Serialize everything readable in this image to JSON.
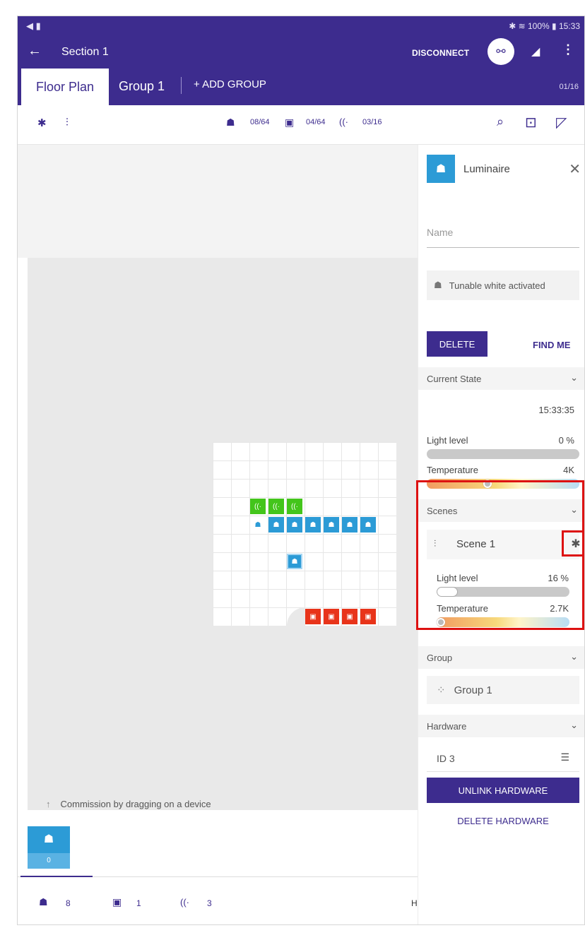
{
  "statusbar": {
    "left_icons": "◀ ▮",
    "right_text": "✱ ≋ 100% ▮ 15:33"
  },
  "appbar": {
    "back_icon": "←",
    "title": "Section 1",
    "disconnect_label": "DISCONNECT",
    "link_icon": "⚯",
    "signal_icon": "◢",
    "more_icon": "⋮"
  },
  "tabs": {
    "floor_plan": "Floor Plan",
    "group1": "Group 1",
    "add_group": "+ ADD GROUP",
    "count": "01/16"
  },
  "toolbar": {
    "settings_icon": "✱",
    "tune_icon": "⫶",
    "lum_icon": "☗",
    "lum_count": "08/64",
    "switch_icon": "▣",
    "switch_count": "04/64",
    "sensor_icon": "((·",
    "sensor_count": "03/16",
    "search_icon": "⌕",
    "fit_icon": "⊡",
    "expand_icon": "◸"
  },
  "canvas": {
    "hint_arrow": "↑",
    "hint": "Commission by dragging on a device"
  },
  "tile": {
    "icon": "☗",
    "count": "0"
  },
  "bottom": {
    "lum_icon": "☗",
    "lum": "8",
    "switch_icon": "▣",
    "switch": "1",
    "sensor_icon": "((·",
    "sensor": "3",
    "faded_label": "H"
  },
  "panel": {
    "icon": "☗",
    "title": "Luminaire",
    "close_icon": "✕",
    "name_placeholder": "Name",
    "tw_icon": "☗",
    "tunable": "Tunable white activated",
    "delete": "DELETE",
    "find_me": "FIND ME",
    "current_state": "Current State",
    "chevron": "⌄",
    "time": "15:33:35",
    "refresh_icon": "⟳",
    "light_level": "Light level",
    "light_value": "0 %",
    "temperature": "Temperature",
    "temp_value": "4K",
    "scenes": "Scenes",
    "scene_icon": "⫶",
    "scene_name": "Scene 1",
    "gear_icon": "✱",
    "scene_light_level": "Light level",
    "scene_light_value": "16 %",
    "scene_temperature": "Temperature",
    "scene_temp_value": "2.7K",
    "group": "Group",
    "group_icon": "⁘",
    "group_name": "Group 1",
    "hardware": "Hardware",
    "hw_id": "ID 3",
    "hw_list_icon": "☰",
    "unlink": "UNLINK HARDWARE",
    "delete_hw": "DELETE HARDWARE"
  },
  "levels": {
    "light": 0.0,
    "temp_knob": 0.4,
    "scene_light": 0.16,
    "scene_temp_knob": 0.0
  },
  "colors": {
    "primary": "#3d2c8e",
    "luminaire": "#2c9bd6",
    "sensor": "#43c51b",
    "switch": "#e8341a",
    "highlight": "#dd1111"
  }
}
